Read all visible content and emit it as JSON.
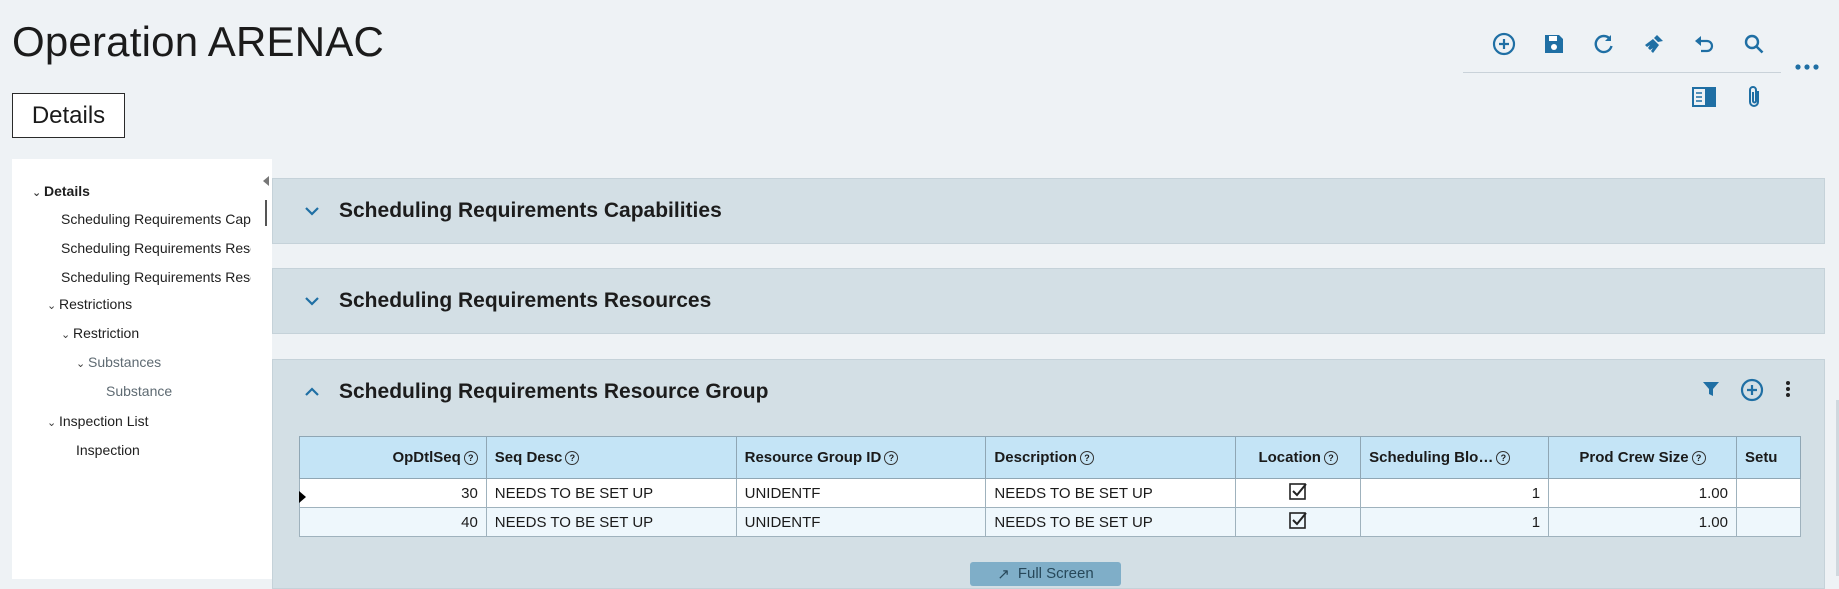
{
  "page": {
    "title": "Operation ARENAC",
    "details_button": "Details"
  },
  "toolbar": {
    "icons": [
      "add-icon",
      "save-icon",
      "refresh-icon",
      "clear-icon",
      "undo-icon",
      "search-icon",
      "more-icon",
      "panel-view-icon",
      "attachment-icon"
    ],
    "accent_color": "#1f6fa4"
  },
  "sidebar": {
    "items": [
      {
        "label": "Details",
        "expanded": true
      },
      {
        "label": "Scheduling Requirements Capabilities"
      },
      {
        "label": "Scheduling Requirements Resources"
      },
      {
        "label": "Scheduling Requirements Resource Group"
      },
      {
        "label": "Restrictions",
        "expanded": true
      },
      {
        "label": "Restriction",
        "expanded": true
      },
      {
        "label": "Substances",
        "expanded": true
      },
      {
        "label": "Substance"
      },
      {
        "label": "Inspection List",
        "expanded": true
      },
      {
        "label": "Inspection"
      }
    ]
  },
  "panels": [
    {
      "title": "Scheduling Requirements Capabilities",
      "expanded": false
    },
    {
      "title": "Scheduling Requirements Resources",
      "expanded": false
    },
    {
      "title": "Scheduling Requirements Resource Group",
      "expanded": true
    }
  ],
  "grid": {
    "columns": [
      "OpDtlSeq",
      "Seq Desc",
      "Resource Group ID",
      "Description",
      "Location",
      "Scheduling Blo…",
      "Prod Crew Size",
      "Setu"
    ],
    "rows": [
      {
        "opdtlseq": "30",
        "seq_desc": "NEEDS TO BE SET UP",
        "resource_group_id": "UNIDENTF",
        "description": "NEEDS TO BE SET UP",
        "location": true,
        "scheduling_blocks": "1",
        "prod_crew_size": "1.00",
        "setup": ""
      },
      {
        "opdtlseq": "40",
        "seq_desc": "NEEDS TO BE SET UP",
        "resource_group_id": "UNIDENTF",
        "description": "NEEDS TO BE SET UP",
        "location": true,
        "scheduling_blocks": "1",
        "prod_crew_size": "1.00",
        "setup": ""
      }
    ],
    "full_screen_label": "Full Screen"
  }
}
